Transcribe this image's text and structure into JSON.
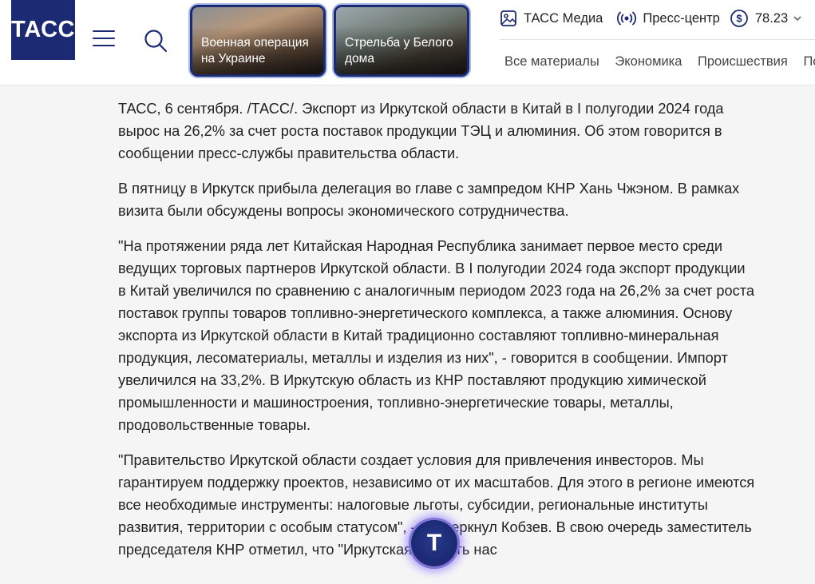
{
  "header": {
    "logo_text": "ТАСС",
    "promo_tiles": [
      {
        "label": "Военная операция на Украине"
      },
      {
        "label": "Стрельба у Белого дома"
      }
    ],
    "top_links": [
      {
        "label": "ТАСС Медиа",
        "icon": "image-icon"
      },
      {
        "label": "Пресс-центр",
        "icon": "broadcast-icon"
      },
      {
        "label": "78.23",
        "icon": "dollar-icon"
      }
    ],
    "sections": [
      "Все материалы",
      "Экономика",
      "Происшествия",
      "Поли"
    ]
  },
  "article": {
    "paragraphs": [
      "ТАСС, 6 сентября. /ТАСС/. Экспорт из Иркутской области в Китай в I полугодии 2024 года вырос на 26,2% за счет роста поставок продукции ТЭЦ и алюминия. Об этом говорится в сообщении пресс-службы правительства области.",
      "В пятницу в Иркутск прибыла делегация во главе с зампредом КНР Хань Чжэном. В рамках визита были обсуждены вопросы экономического сотрудничества.",
      "\"На протяжении ряда лет Китайская Народная Республика занимает первое место среди ведущих торговых партнеров Иркутской области. В I полугодии 2024 года экспорт продукции в Китай увеличился по сравнению с аналогичным периодом 2023 года на 26,2% за счет роста поставок группы товаров топливно-энергетического комплекса, а также алюминия. Основу экспорта из Иркутской области в Китай традиционно составляют топливно-минеральная продукция, лесоматериалы, металлы и изделия из них\", - говорится в сообщении. Импорт увеличился на 33,2%. В Иркутскую область из КНР поставляют продукцию химической промышленности и машиностроения, топливно-энергетические товары, металлы, продовольственные товары.",
      "\"Правительство Иркутской области создает условия для привлечения инвесторов. Мы гарантируем поддержку проектов, независимо от их масштабов. Для этого в регионе имеются все необходимые инструменты: налоговые льготы, субсидии, региональные институты развития, территории с особым статусом\", - подчеркнул Кобзев. В свою очередь заместитель председателя КНР отметил, что \"Иркутская область нас"
    ]
  },
  "assistant_button": {
    "label": "T"
  },
  "colors": {
    "brand": "#1b2a73",
    "background": "#f5f5f5"
  }
}
